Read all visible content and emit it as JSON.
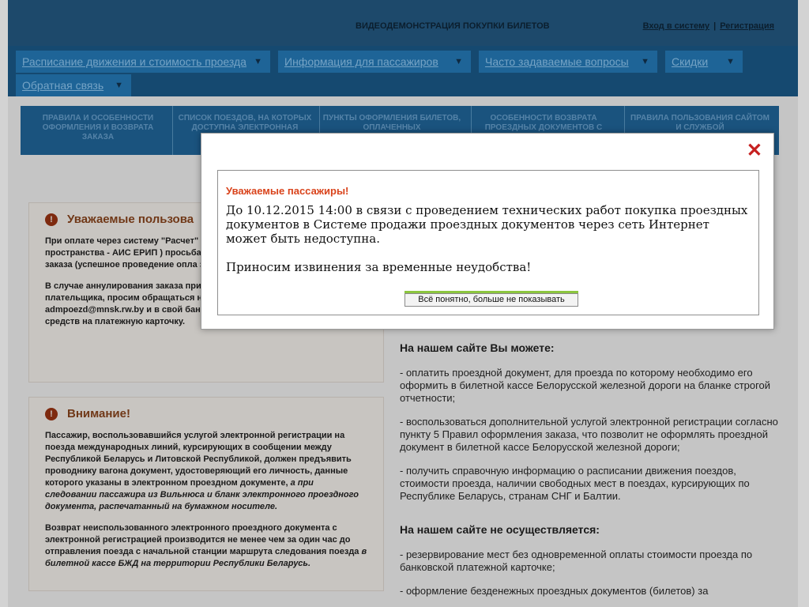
{
  "header": {
    "center_title": "ВИДЕОДЕМОНСТРАЦИЯ ПОКУПКИ БИЛЕТОВ",
    "login": "Вход в систему",
    "sep": "|",
    "register": "Регистрация"
  },
  "nav": {
    "items": [
      {
        "label": "Расписание движения и стоимость проезда"
      },
      {
        "label": "Информация для пассажиров"
      },
      {
        "label": "Часто задаваемые вопросы"
      },
      {
        "label": "Скидки"
      },
      {
        "label": "Обратная связь"
      }
    ],
    "caret": "▼"
  },
  "tabs": [
    {
      "label": "ПРАВИЛА И ОСОБЕННОСТИ ОФОРМЛЕНИЯ И ВОЗВРАТА ЗАКАЗА"
    },
    {
      "label": "СПИСОК ПОЕЗДОВ, НА КОТОРЫХ ДОСТУПНА ЭЛЕКТРОННАЯ"
    },
    {
      "label": "ПУНКТЫ ОФОРМЛЕНИЯ БИЛЕТОВ, ОПЛАЧЕННЫХ"
    },
    {
      "label": "ОСОБЕННОСТИ ВОЗВРАТА ПРОЕЗДНЫХ ДОКУМЕНТОВ С"
    },
    {
      "label": "ПРАВИЛА ПОЛЬЗОВАНИЯ САЙТОМ И СЛУЖБОЙ"
    }
  ],
  "notice1": {
    "icon": "!",
    "title": "Уважаемые пользова",
    "p1": "При оплате через систему \"Расчет\" информационную систему единого пространства - АИС ЕРИП ) просьба сообщения, передаваемые по элек заказа (успешное проведение опла заказа).",
    "p2": "В случае аннулирования заказа при этом денежные средства карточки плательщика, просим обращаться на электронный адрес admpoezd@mnsk.rw.by и в свой банк по вопросу возврата денежных средств на платежную карточку."
  },
  "notice2": {
    "icon": "!",
    "title": "Внимание!",
    "p1_start": "Пассажир, воспользовавшийся услугой электронной регистрации на поезда международных линий, курсирующих в сообщении между Республикой Беларусь и Литовской Республикой, должен предъявить проводнику вагона документ, удостоверяющий его личность, данные которого указаны в электронном проездном документе, ",
    "p1_em": "а при следовании пассажира из Вильнюса и бланк электронного проездного документа, распечатанный на бумажном носителе.",
    "p2_start": "Возврат неиспользованного электронного проездного документа с электронной регистрацией производится не менее чем за один час до отправления поезда с начальной станции маршрута следования поезда ",
    "p2_em": "в билетной кассе БЖД на территории Республики Беларусь."
  },
  "right": {
    "can_title": "На нашем сайте Вы можете:",
    "can1": "- оплатить проездной документ, для проезда по которому необходимо его оформить в билетной кассе Белорусской железной дороги на бланке строгой отчетности;",
    "can2": "- воспользоваться дополнительной услугой электронной регистрации согласно пункту 5 Правил оформления заказа, что позволит не оформлять проездной документ в билетной кассе Белорусской железной дороги;",
    "can3": "- получить справочную информацию о расписании движения поездов, стоимости проезда, наличии свободных мест в поездах, курсирующих по Республике Беларусь, странам СНГ и Балтии.",
    "cannot_title": "На нашем сайте не осуществляется:",
    "cannot1": "- резервирование мест без одновременной оплаты стоимости проезда по банковской платежной карточке;",
    "cannot2": "- оформление безденежных проездных документов (билетов) за"
  },
  "modal": {
    "close": "✕",
    "title": "Уважаемые пассажиры!",
    "msg1": "До 10.12.2015 14:00 в связи с проведением технических работ покупка проездных документов в Системе продажи проездных документов через сеть Интернет может быть недоступна.",
    "msg2": "Приносим извинения за временные неудобства!",
    "button": "Всё понятно, больше не показывать"
  }
}
